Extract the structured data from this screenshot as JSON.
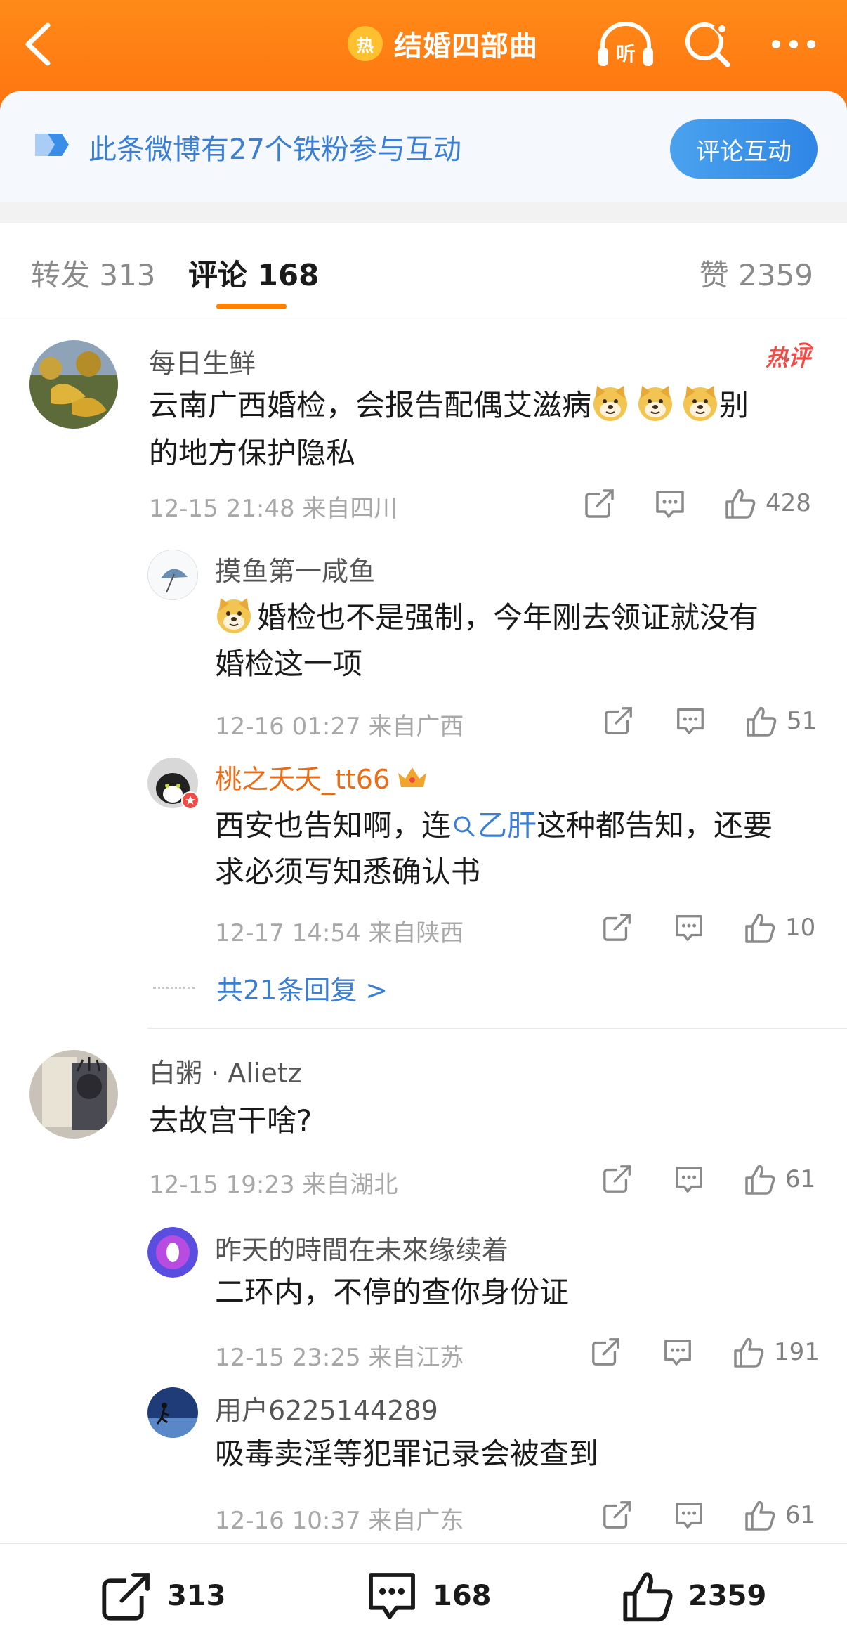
{
  "header": {
    "hot_badge": "热",
    "title": "结婚四部曲",
    "listen_label": "听",
    "accent": "#ff7a12"
  },
  "banner": {
    "text": "此条微博有27个铁粉参与互动",
    "button": "评论互动"
  },
  "tabs": {
    "repost": "转发 313",
    "comment": "评论 168",
    "like": "赞 2359"
  },
  "comments": [
    {
      "name": "每日生鲜",
      "hot_tag": "热评",
      "text_a": "云南广西婚检，会报告配偶艾滋病",
      "text_b": "别",
      "text_c": "的地方保护隐私",
      "meta": "12-15 21:48  来自四川",
      "likes": "428",
      "replies": [
        {
          "name": "摸鱼第一咸鱼",
          "text_a": "婚检也不是强制，今年刚去领证就没有",
          "text_b": "婚检这一项",
          "meta": "12-16 01:27  来自广西",
          "likes": "51"
        },
        {
          "name": "桃之夭夭_tt66",
          "text_pre": "西安也告知啊，连",
          "topic": "乙肝",
          "text_post": "这种都告知，还要",
          "text_b": "求必须写知悉确认书",
          "meta": "12-17 14:54  来自陕西",
          "likes": "10"
        }
      ],
      "more_replies": "共21条回复 >"
    },
    {
      "name": "白粥 · Alietz",
      "text_a": "去故宫干啥?",
      "meta": "12-15 19:23  来自湖北",
      "likes": "61",
      "replies": [
        {
          "name": "昨天的時間在未來缘续着",
          "text_a": "二环内，不停的查你身份证",
          "meta": "12-15 23:25  来自江苏",
          "likes": "191"
        },
        {
          "name": "用户6225144289",
          "text_a": "吸毒卖淫等犯罪记录会被查到",
          "meta": "12-16 10:37  来自广东",
          "likes": "61"
        }
      ]
    }
  ],
  "bottom_bar": {
    "reposts": "313",
    "comments": "168",
    "likes": "2359"
  }
}
